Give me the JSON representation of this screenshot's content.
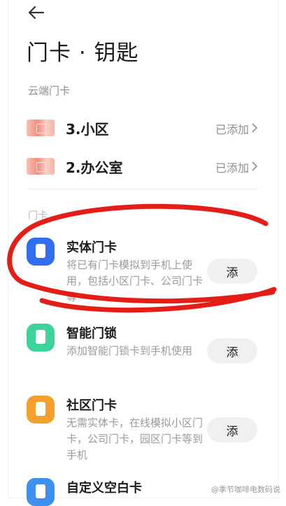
{
  "page": {
    "title": "门卡 · 钥匙"
  },
  "cloud": {
    "section_label": "云端门卡",
    "items": [
      {
        "name": "3.小区",
        "status": "已添加"
      },
      {
        "name": "2.办公室",
        "status": "已添加"
      }
    ]
  },
  "physical": {
    "section_label": "门卡",
    "items": [
      {
        "title": "实体门卡",
        "desc": "将已有门卡模拟到手机上使用，包括小区门卡、公司门卡等",
        "button": "添",
        "icon": "card-icon",
        "color": "#2f6ff0"
      },
      {
        "title": "智能门锁",
        "desc": "添加智能门锁卡到手机使用",
        "button": "添",
        "icon": "card-icon",
        "color": "#3dd39b"
      },
      {
        "title": "社区门卡",
        "desc": "无需实体卡，在线模拟小区门卡，公司门卡，园区门卡等到手机",
        "button": "添",
        "icon": "card-icon",
        "color": "#f6a02c"
      },
      {
        "title": "自定义空白卡",
        "icon": "card-icon",
        "color": "#3d8ff0"
      }
    ]
  },
  "watermark": "@季节咖啡电数码说",
  "annotation_color": "#e3120b"
}
